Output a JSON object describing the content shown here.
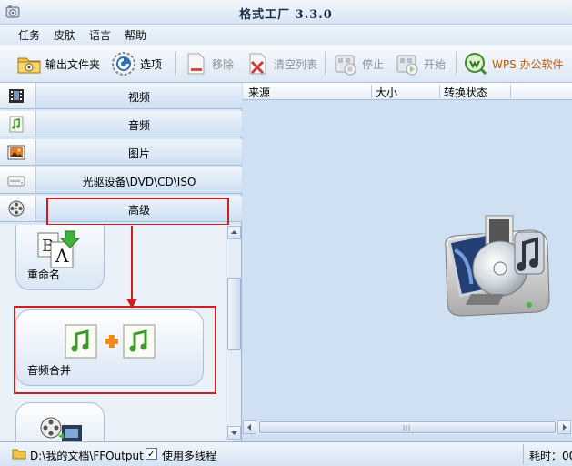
{
  "window": {
    "title": "格式工厂  3.3.0"
  },
  "menu": {
    "items": [
      "任务",
      "皮肤",
      "语言",
      "帮助"
    ]
  },
  "toolbar": {
    "output_folder": "输出文件夹",
    "options": "选项",
    "remove": "移除",
    "clear_list": "清空列表",
    "stop": "停止",
    "start": "开始",
    "wps": "WPS 办公软件"
  },
  "categories": {
    "video": "视频",
    "audio": "音频",
    "image": "图片",
    "optical": "光驱设备\\DVD\\CD\\ISO",
    "advanced": "高级"
  },
  "tiles": {
    "rename": "重命名",
    "audio_merge": "音频合并"
  },
  "file_list": {
    "columns": [
      "来源",
      "大小",
      "转换状态"
    ]
  },
  "status": {
    "output_path": "D:\\我的文档\\FFOutput",
    "multithread_label": "使用多线程",
    "multithread_checked": true,
    "elapsed": "耗时：00"
  },
  "colors": {
    "annotation_red": "#cc1f1f",
    "panel_blue": "#cfe0f3"
  }
}
